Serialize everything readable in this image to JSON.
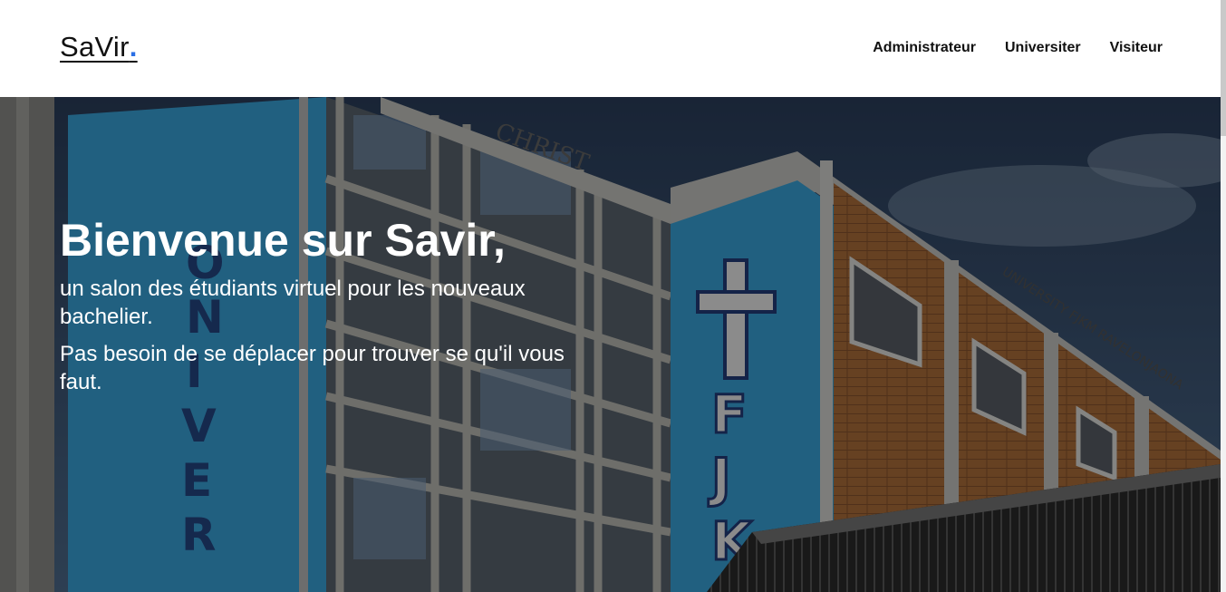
{
  "header": {
    "brand_text": "SaVir",
    "brand_dot": ".",
    "nav": {
      "admin": "Administrateur",
      "university": "Universiter",
      "visitor": "Visiteur"
    }
  },
  "hero": {
    "title": "Bienvenue sur Savir,",
    "subtitle": "un salon des étudiants virtuel pour les nouveaux bachelier.",
    "tagline": "Pas besoin de se déplacer pour trouver se qu'il vous faut."
  },
  "colors": {
    "accent": "#2b6fe5",
    "header_bg": "#ffffff",
    "building_blue": "#39a6dd",
    "brick": "#b0703c"
  }
}
